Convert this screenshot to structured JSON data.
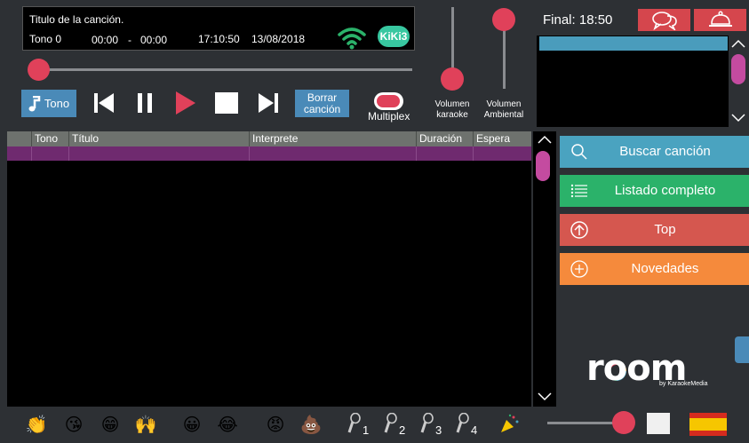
{
  "info": {
    "song_title": "Titulo de la canción.",
    "tone": "Tono 0",
    "time_current": "00:00",
    "time_separator": "-",
    "time_total": "00:00",
    "clock": "17:10:50",
    "date": "13/08/2018",
    "brand_logo": "KiKi3"
  },
  "progress": {
    "position_fraction": 0.0
  },
  "controls": {
    "tone_label": "Tono",
    "borrar_label": "Borrar canción",
    "multiplex_label": "Multiplex"
  },
  "volume": {
    "karaoke_label": "Volumen karaoke",
    "karaoke_level": 0.0,
    "ambient_label": "Volumen Ambiental",
    "ambient_level": 1.0
  },
  "top_right": {
    "final_label": "Final: 18:50",
    "chat_icon": "chat-bubbles-icon",
    "service_icon": "service-bell-icon"
  },
  "table": {
    "columns": [
      "",
      "Tono",
      "Título",
      "Interprete",
      "Duración",
      "Espera"
    ],
    "rows": [
      [
        "",
        "",
        "",
        "",
        "",
        ""
      ]
    ]
  },
  "actions": [
    {
      "label": "Buscar canción",
      "icon": "search-icon",
      "color": "#4aa3c0"
    },
    {
      "label": "Listado completo",
      "icon": "list-icon",
      "color": "#2bb26a"
    },
    {
      "label": "Top",
      "icon": "arrow-up-circle-icon",
      "color": "#d5574f"
    },
    {
      "label": "Novedades",
      "icon": "plus-circle-icon",
      "color": "#f58a3c"
    }
  ],
  "logo": {
    "name": "room",
    "byline": "by KaraokeMedia"
  },
  "bottom": {
    "emojis": [
      "👏",
      "😘",
      "😁",
      "🙌",
      "😀",
      "😂",
      "😡",
      "💩"
    ],
    "mics": [
      "1",
      "2",
      "3",
      "4"
    ],
    "volume_level": 1.0,
    "language_flag": "spain-flag-icon"
  },
  "colors": {
    "accent": "#e0415a",
    "blue_button": "#4a8ab8",
    "scroll_thumb": "#c44ba0",
    "row_highlight": "#6f2a6f"
  }
}
